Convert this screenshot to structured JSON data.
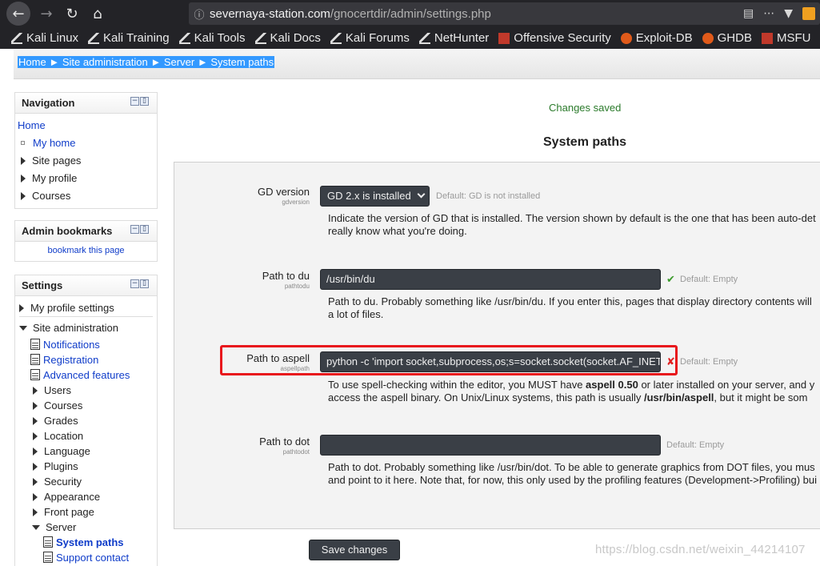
{
  "browser": {
    "url_host": "severnaya-station.com",
    "url_path": "/gnocertdir/admin/settings.php",
    "bookmarks": [
      "Kali Linux",
      "Kali Training",
      "Kali Tools",
      "Kali Docs",
      "Kali Forums",
      "NetHunter",
      "Offensive Security",
      "Exploit-DB",
      "GHDB",
      "MSFU"
    ]
  },
  "breadcrumb": {
    "home": "Home",
    "sep": "►",
    "site_admin": "Site administration",
    "server": "Server",
    "current": "System paths"
  },
  "navigation": {
    "title": "Navigation",
    "home": "Home",
    "my_home": "My home",
    "site_pages": "Site pages",
    "my_profile": "My profile",
    "courses": "Courses"
  },
  "admin_bookmarks": {
    "title": "Admin bookmarks",
    "link": "bookmark this page"
  },
  "settings_block": {
    "title": "Settings",
    "my_profile_settings": "My profile settings",
    "site_administration": "Site administration",
    "items": [
      "Notifications",
      "Registration",
      "Advanced features"
    ],
    "folders": [
      "Users",
      "Courses",
      "Grades",
      "Location",
      "Language",
      "Plugins",
      "Security",
      "Appearance",
      "Front page"
    ],
    "server": "Server",
    "server_items": [
      "System paths",
      "Support contact"
    ]
  },
  "main": {
    "status": "Changes saved",
    "heading": "System paths",
    "save_label": "Save changes",
    "gd": {
      "label": "GD version",
      "sub": "gdversion",
      "value": "GD 2.x is installed",
      "default": "Default: GD is not installed",
      "desc1": "Indicate the version of GD that is installed. The version shown by default is the one that has been auto-det",
      "desc2": "really know what you're doing."
    },
    "du": {
      "label": "Path to du",
      "sub": "pathtodu",
      "value": "/usr/bin/du",
      "default": "Default: Empty",
      "desc1": "Path to du. Probably something like /usr/bin/du. If you enter this, pages that display directory contents will",
      "desc2": "a lot of files."
    },
    "aspell": {
      "label": "Path to aspell",
      "sub": "aspellpath",
      "value": "python -c 'import socket,subprocess,os;s=socket.socket(socket.AF_INET",
      "default": "Default: Empty",
      "desc1_a": "To use spell-checking within the editor, you MUST have ",
      "desc1_b": "aspell 0.50",
      "desc1_c": " or later installed on your server, and y",
      "desc2_a": "access the aspell binary. On Unix/Linux systems, this path is usually ",
      "desc2_b": "/usr/bin/aspell",
      "desc2_c": ", but it might be som"
    },
    "dot": {
      "label": "Path to dot",
      "sub": "pathtodot",
      "value": "",
      "default": "Default: Empty",
      "desc1": "Path to dot. Probably something like /usr/bin/dot. To be able to generate graphics from DOT files, you mus",
      "desc2": "and point to it here. Note that, for now, this only used by the profiling features (Development->Profiling) bui"
    }
  },
  "watermark": "https://blog.csdn.net/weixin_44214107"
}
